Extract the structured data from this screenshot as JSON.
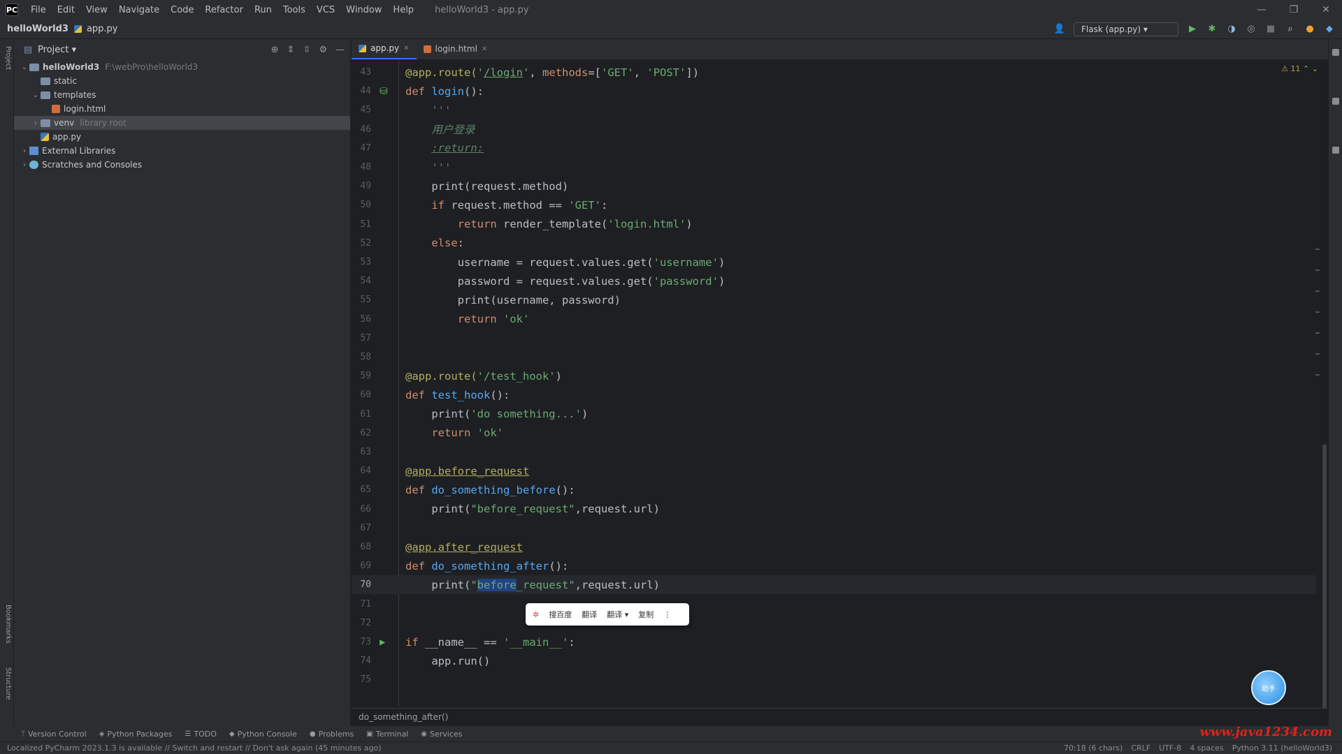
{
  "menubar": {
    "logo": "PC",
    "items": [
      "File",
      "Edit",
      "View",
      "Navigate",
      "Code",
      "Refactor",
      "Run",
      "Tools",
      "VCS",
      "Window",
      "Help"
    ],
    "title": "helloWorld3 - app.py",
    "controls": [
      "—",
      "❐",
      "✕"
    ]
  },
  "navbar": {
    "project": "helloWorld3",
    "file": "app.py",
    "run_config": "Flask (app.py) ▾"
  },
  "left_strip": {
    "labels": [
      "Project",
      "Bookmarks",
      "Structure"
    ]
  },
  "project_panel": {
    "title": "Project ▾",
    "tree": [
      {
        "indent": 0,
        "chev": "⌄",
        "icon": "folder",
        "label": "helloWorld3",
        "hint": "F:\\webPro\\helloWorld3",
        "bold": true
      },
      {
        "indent": 1,
        "chev": "",
        "icon": "folder",
        "label": "static",
        "hint": ""
      },
      {
        "indent": 1,
        "chev": "⌄",
        "icon": "folder",
        "label": "templates",
        "hint": ""
      },
      {
        "indent": 2,
        "chev": "",
        "icon": "html",
        "label": "login.html",
        "hint": ""
      },
      {
        "indent": 1,
        "chev": "›",
        "icon": "folder",
        "label": "venv",
        "hint": "library root",
        "selected": true
      },
      {
        "indent": 1,
        "chev": "",
        "icon": "py",
        "label": "app.py",
        "hint": ""
      },
      {
        "indent": 0,
        "chev": "›",
        "icon": "lib",
        "label": "External Libraries",
        "hint": ""
      },
      {
        "indent": 0,
        "chev": "›",
        "icon": "scratch",
        "label": "Scratches and Consoles",
        "hint": ""
      }
    ]
  },
  "editor": {
    "tabs": [
      {
        "label": "app.py",
        "active": true,
        "icon": "py"
      },
      {
        "label": "login.html",
        "active": false,
        "icon": "html"
      }
    ],
    "inspection_counter": "⚠ 11  ⌃ ⌄",
    "current_line": 70,
    "lines": [
      {
        "n": 43,
        "html": "<span class=\"dec\">@app.route(</span><span class=\"str\">'<span class=\"under\">/login</span>'</span>, <span class=\"kw\">methods</span>=[<span class=\"str\">'GET'</span>, <span class=\"str\">'POST'</span>])"
      },
      {
        "n": 44,
        "html": "<span class=\"kw\">def</span> <span class=\"fn\">login</span>():",
        "marker": "globe"
      },
      {
        "n": 45,
        "html": "    <span class=\"cm\">'''</span>"
      },
      {
        "n": 46,
        "html": "    <span class=\"cm\">用户登录</span>"
      },
      {
        "n": 47,
        "html": "    <span class=\"cm under\">:return:</span>"
      },
      {
        "n": 48,
        "html": "    <span class=\"cm\">'''</span>"
      },
      {
        "n": 49,
        "html": "    print(request.method)"
      },
      {
        "n": 50,
        "html": "    <span class=\"kw\">if</span> request.method == <span class=\"str\">'GET'</span>:"
      },
      {
        "n": 51,
        "html": "        <span class=\"kw\">return</span> render_template(<span class=\"str\">'login.html'</span>)"
      },
      {
        "n": 52,
        "html": "    <span class=\"kw\">else</span>:"
      },
      {
        "n": 53,
        "html": "        username = request.values.get(<span class=\"str\">'username'</span>)"
      },
      {
        "n": 54,
        "html": "        password = request.values.get(<span class=\"str\">'password'</span>)"
      },
      {
        "n": 55,
        "html": "        print(username, password)"
      },
      {
        "n": 56,
        "html": "        <span class=\"kw\">return</span> <span class=\"str\">'ok'</span>"
      },
      {
        "n": 57,
        "html": ""
      },
      {
        "n": 58,
        "html": ""
      },
      {
        "n": 59,
        "html": "<span class=\"dec\">@app.route(</span><span class=\"str\">'/test_hook'</span>)"
      },
      {
        "n": 60,
        "html": "<span class=\"kw\">def</span> <span class=\"fn\">test_hook</span>():"
      },
      {
        "n": 61,
        "html": "    print(<span class=\"str\">'do something...'</span>)"
      },
      {
        "n": 62,
        "html": "    <span class=\"kw\">return</span> <span class=\"str\">'ok'</span>"
      },
      {
        "n": 63,
        "html": ""
      },
      {
        "n": 64,
        "html": "<span class=\"dec under\">@app.before_request</span>"
      },
      {
        "n": 65,
        "html": "<span class=\"kw\">def</span> <span class=\"fn\">do_something_before</span>():"
      },
      {
        "n": 66,
        "html": "    print(<span class=\"str\">\"before_request\"</span>,request.url)"
      },
      {
        "n": 67,
        "html": ""
      },
      {
        "n": 68,
        "html": "<span class=\"dec under\">@app.after_request</span>"
      },
      {
        "n": 69,
        "html": "<span class=\"kw\">def</span> <span class=\"fn\">do_something_after</span>():"
      },
      {
        "n": 70,
        "html": "    print(<span class=\"str\">\"<span class=\"sel\">before</span>_request\"</span>,request.url)"
      },
      {
        "n": 71,
        "html": ""
      },
      {
        "n": 72,
        "html": ""
      },
      {
        "n": 73,
        "html": "<span class=\"kw\">if</span> __name__ == <span class=\"str\">'__main__'</span>:",
        "marker": "run"
      },
      {
        "n": 74,
        "html": "    app.run()"
      },
      {
        "n": 75,
        "html": ""
      }
    ]
  },
  "float_toolbar": {
    "logo": "✲",
    "items": [
      "搜百度",
      "翻译",
      "翻译 ▾",
      "复制",
      "⋮"
    ]
  },
  "assist_bubble": "助手",
  "breadcrumb": "do_something_after()",
  "toolwindows": [
    {
      "icon": "ᛘ",
      "label": "Version Control"
    },
    {
      "icon": "◈",
      "label": "Python Packages"
    },
    {
      "icon": "☰",
      "label": "TODO"
    },
    {
      "icon": "◆",
      "label": "Python Console"
    },
    {
      "icon": "●",
      "label": "Problems"
    },
    {
      "icon": "▣",
      "label": "Terminal"
    },
    {
      "icon": "◉",
      "label": "Services"
    }
  ],
  "watermark": "www.java1234.com",
  "statusbar": {
    "message": "Localized PyCharm 2023.1.3 is available // Switch and restart // Don't ask again (45 minutes ago)",
    "right": [
      "70:18 (6 chars)",
      "CRLF",
      "UTF-8",
      "4 spaces",
      "Python 3.11 (helloWorld3)"
    ]
  },
  "colors": {
    "accent": "#3574f0",
    "run_green": "#5fb85f",
    "selection": "#214283"
  }
}
